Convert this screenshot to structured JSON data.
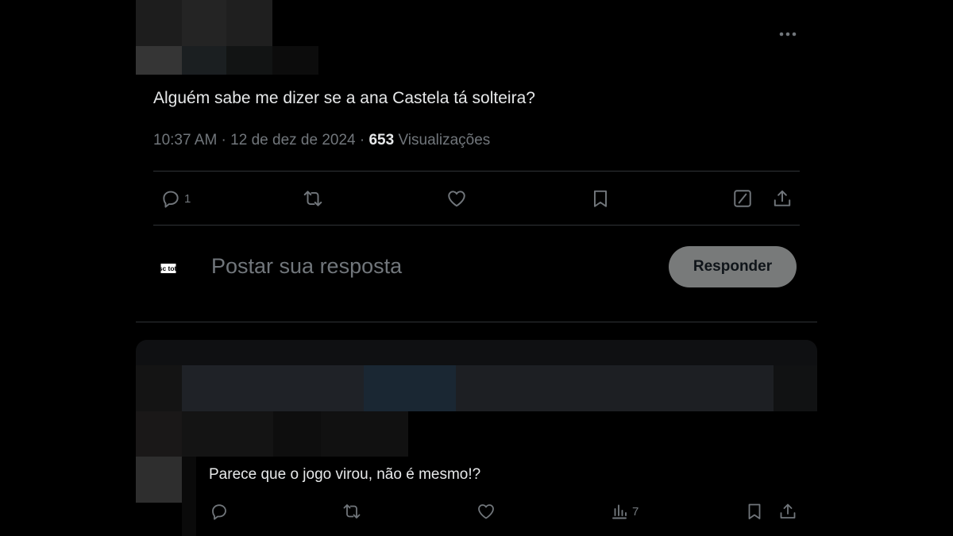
{
  "tweet": {
    "text": "Alguém sabe me dizer se a ana Castela tá solteira?",
    "time": "10:37 AM",
    "separator": " · ",
    "date": "12 de dez de 2024",
    "views_count": "653",
    "views_label": "Visualizações",
    "reply_count": "1",
    "icons": [
      "more-icon",
      "reply-icon",
      "retweet-icon",
      "like-icon",
      "bookmark-icon",
      "grok-icon",
      "share-icon"
    ]
  },
  "compose": {
    "avatar_text": "nsc total",
    "placeholder": "Postar sua resposta",
    "button_label": "Responder"
  },
  "reply": {
    "text": "Parece que o jogo virou, não é mesmo!?",
    "views_count": "7",
    "icons": [
      "reply-icon",
      "retweet-icon",
      "like-icon",
      "views-icon",
      "bookmark-icon",
      "share-icon"
    ]
  },
  "colors": {
    "background": "#000000",
    "text": "#e7e9ea",
    "secondary_text": "#71767b",
    "border": "#2f3336",
    "reply_button": "#787a7a"
  }
}
